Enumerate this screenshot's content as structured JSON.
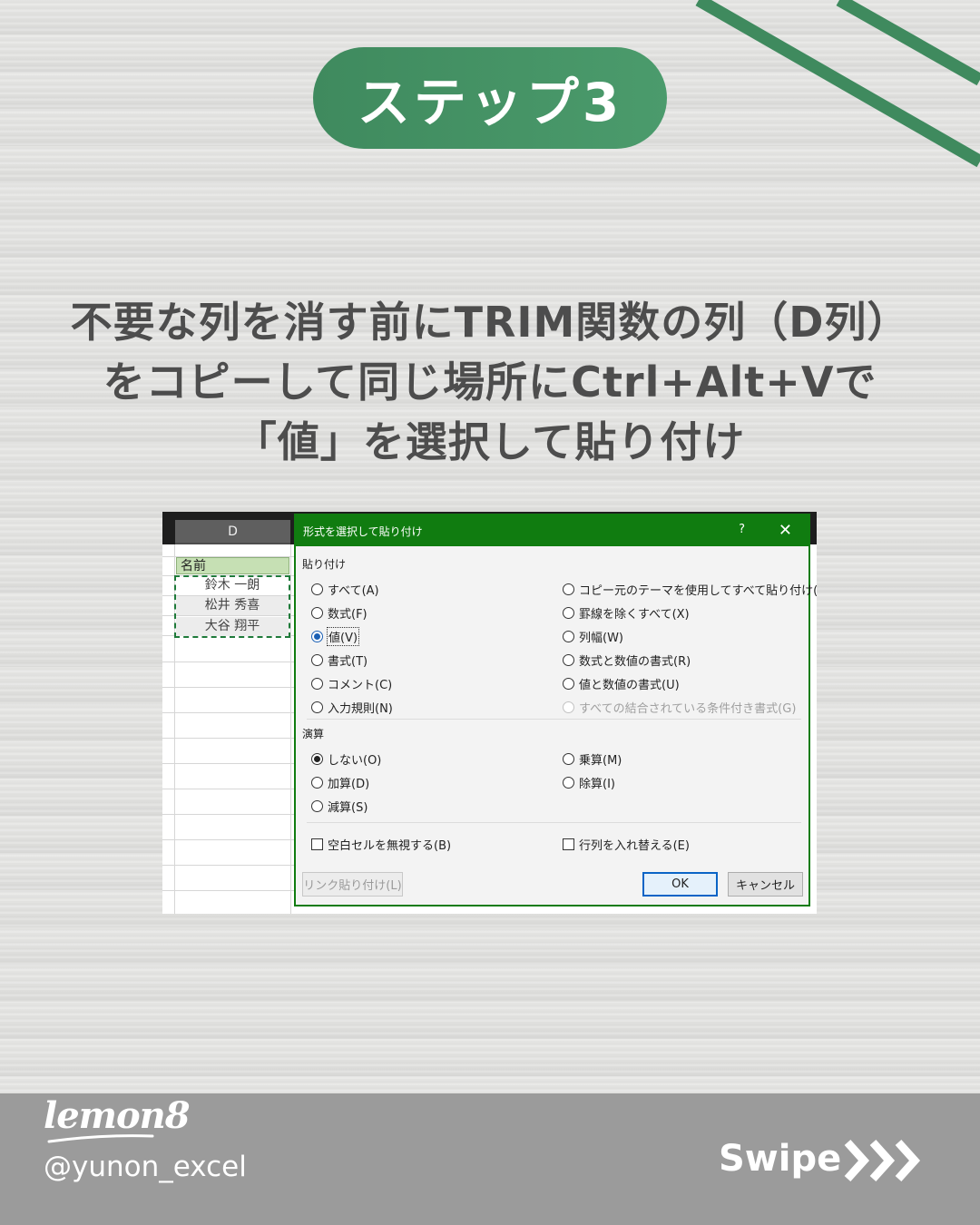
{
  "step_badge": "ステップ3",
  "headline": [
    "不要な列を消す前にTRIM関数の列（D列）",
    "をコピーして同じ場所にCtrl+Alt+Vで",
    "「値」を選択して貼り付け"
  ],
  "colors": {
    "accent_green": "#3f8a5e",
    "dialog_green": "#107c10",
    "footer_gray": "#9b9b9b"
  },
  "sheet": {
    "column_header": "D",
    "header_cell": "名前",
    "names": [
      "鈴木 一朗",
      "松井 秀喜",
      "大谷 翔平"
    ]
  },
  "dialog": {
    "title": "形式を選択して貼り付け",
    "help_glyph": "?",
    "close_glyph": "✕",
    "paste_section": "貼り付け",
    "paste_left": [
      {
        "label": "すべて(A)",
        "selected": false
      },
      {
        "label": "数式(F)",
        "selected": false
      },
      {
        "label": "値(V)",
        "selected": true
      },
      {
        "label": "書式(T)",
        "selected": false
      },
      {
        "label": "コメント(C)",
        "selected": false
      },
      {
        "label": "入力規則(N)",
        "selected": false
      }
    ],
    "paste_right": [
      {
        "label": "コピー元のテーマを使用してすべて貼り付け(H)",
        "disabled": false
      },
      {
        "label": "罫線を除くすべて(X)",
        "disabled": false
      },
      {
        "label": "列幅(W)",
        "disabled": false
      },
      {
        "label": "数式と数値の書式(R)",
        "disabled": false
      },
      {
        "label": "値と数値の書式(U)",
        "disabled": false
      },
      {
        "label": "すべての結合されている条件付き書式(G)",
        "disabled": true
      }
    ],
    "operation_section": "演算",
    "operation_left": [
      {
        "label": "しない(O)",
        "selected": true
      },
      {
        "label": "加算(D)",
        "selected": false
      },
      {
        "label": "減算(S)",
        "selected": false
      }
    ],
    "operation_right": [
      {
        "label": "乗算(M)",
        "selected": false
      },
      {
        "label": "除算(I)",
        "selected": false
      }
    ],
    "skip_blanks": "空白セルを無視する(B)",
    "transpose": "行列を入れ替える(E)",
    "paste_link": "リンク貼り付け(L)",
    "ok": "OK",
    "cancel": "キャンセル"
  },
  "footer": {
    "brand": "lemon8",
    "handle": "@yunon_excel",
    "swipe": "Swipe"
  }
}
